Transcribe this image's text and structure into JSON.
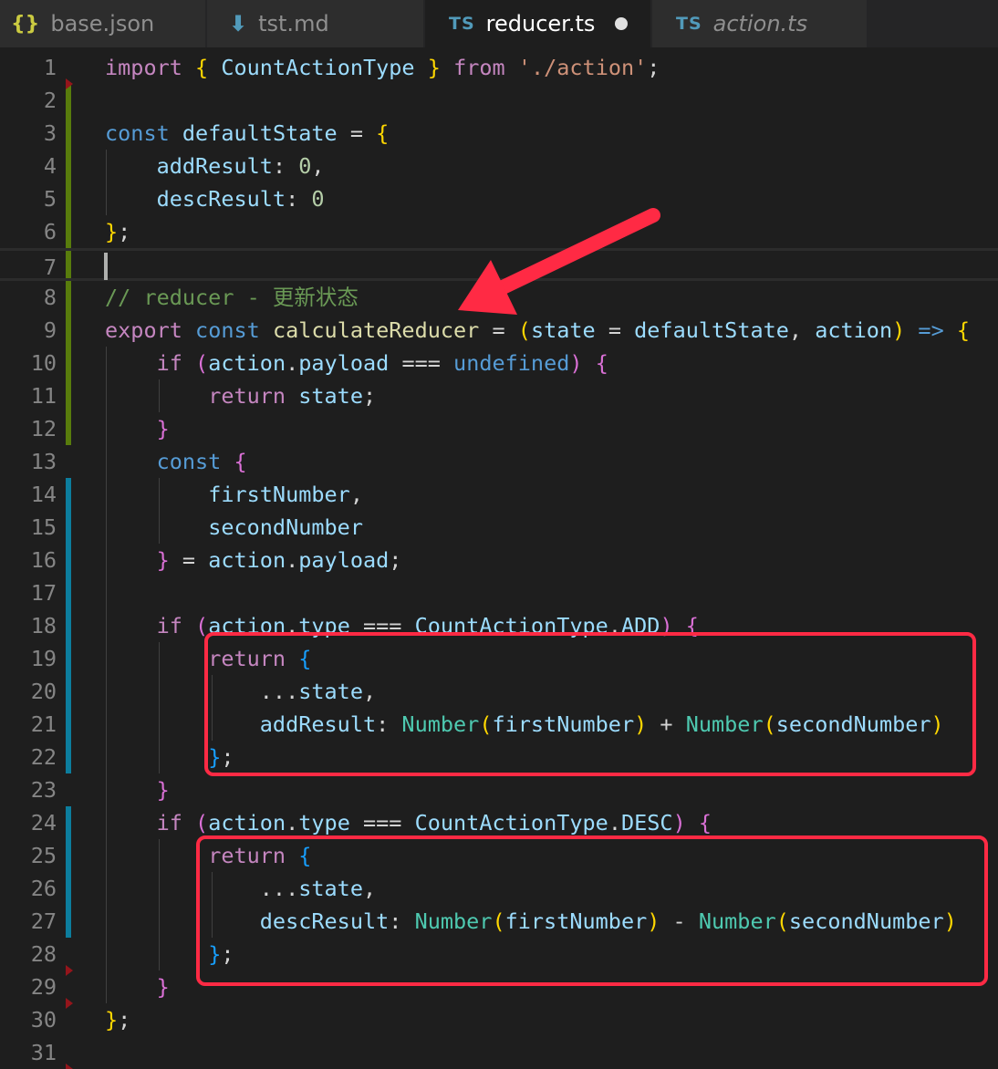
{
  "tabs": [
    {
      "label": "base.json",
      "icon": "json-file-icon",
      "glyph": "{}",
      "active": false
    },
    {
      "label": "tst.md",
      "icon": "markdown-file-icon",
      "glyph": "⬇",
      "active": false
    },
    {
      "label": "reducer.ts",
      "icon": "typescript-file-icon",
      "glyph": "TS",
      "active": true,
      "dirty": true
    },
    {
      "label": "action.ts",
      "icon": "typescript-file-icon",
      "glyph": "TS",
      "active": false,
      "preview": true
    }
  ],
  "editor": {
    "current_line": 7,
    "lines": [
      {
        "n": "1",
        "tokens": [
          [
            "kw",
            "import"
          ],
          [
            "p",
            " "
          ],
          [
            "b1",
            "{"
          ],
          [
            "p",
            " "
          ],
          [
            "id",
            "CountActionType"
          ],
          [
            "p",
            " "
          ],
          [
            "b1",
            "}"
          ],
          [
            "p",
            " "
          ],
          [
            "kw",
            "from"
          ],
          [
            "p",
            " "
          ],
          [
            "str",
            "'./action'"
          ],
          [
            "p",
            ";"
          ]
        ]
      },
      {
        "n": "2",
        "tokens": []
      },
      {
        "n": "3",
        "tokens": [
          [
            "st",
            "const"
          ],
          [
            "p",
            " "
          ],
          [
            "id",
            "defaultState"
          ],
          [
            "p",
            " = "
          ],
          [
            "b1",
            "{"
          ]
        ]
      },
      {
        "n": "4",
        "tokens": [
          [
            "p",
            "    "
          ],
          [
            "id",
            "addResult"
          ],
          [
            "p",
            ": "
          ],
          [
            "num",
            "0"
          ],
          [
            "p",
            ","
          ]
        ]
      },
      {
        "n": "5",
        "tokens": [
          [
            "p",
            "    "
          ],
          [
            "id",
            "descResult"
          ],
          [
            "p",
            ": "
          ],
          [
            "num",
            "0"
          ]
        ]
      },
      {
        "n": "6",
        "tokens": [
          [
            "b1",
            "}"
          ],
          [
            "p",
            ";"
          ]
        ]
      },
      {
        "n": "7",
        "tokens": []
      },
      {
        "n": "8",
        "tokens": [
          [
            "cm",
            "// reducer - 更新状态"
          ]
        ]
      },
      {
        "n": "9",
        "tokens": [
          [
            "kw",
            "export"
          ],
          [
            "p",
            " "
          ],
          [
            "st",
            "const"
          ],
          [
            "p",
            " "
          ],
          [
            "fn",
            "calculateReducer"
          ],
          [
            "p",
            " = "
          ],
          [
            "b1",
            "("
          ],
          [
            "id",
            "state"
          ],
          [
            "p",
            " = "
          ],
          [
            "id",
            "defaultState"
          ],
          [
            "p",
            ", "
          ],
          [
            "id",
            "action"
          ],
          [
            "b1",
            ")"
          ],
          [
            "p",
            " "
          ],
          [
            "st",
            "=>"
          ],
          [
            "p",
            " "
          ],
          [
            "b1",
            "{"
          ]
        ]
      },
      {
        "n": "10",
        "tokens": [
          [
            "p",
            "    "
          ],
          [
            "kw",
            "if"
          ],
          [
            "p",
            " "
          ],
          [
            "b2",
            "("
          ],
          [
            "id",
            "action"
          ],
          [
            "p",
            "."
          ],
          [
            "id",
            "payload"
          ],
          [
            "p",
            " === "
          ],
          [
            "st",
            "undefined"
          ],
          [
            "b2",
            ")"
          ],
          [
            "p",
            " "
          ],
          [
            "b2",
            "{"
          ]
        ]
      },
      {
        "n": "11",
        "tokens": [
          [
            "p",
            "        "
          ],
          [
            "kw",
            "return"
          ],
          [
            "p",
            " "
          ],
          [
            "id",
            "state"
          ],
          [
            "p",
            ";"
          ]
        ]
      },
      {
        "n": "12",
        "tokens": [
          [
            "p",
            "    "
          ],
          [
            "b2",
            "}"
          ]
        ]
      },
      {
        "n": "13",
        "tokens": [
          [
            "p",
            "    "
          ],
          [
            "st",
            "const"
          ],
          [
            "p",
            " "
          ],
          [
            "b2",
            "{"
          ]
        ]
      },
      {
        "n": "14",
        "tokens": [
          [
            "p",
            "        "
          ],
          [
            "id",
            "firstNumber"
          ],
          [
            "p",
            ","
          ]
        ]
      },
      {
        "n": "15",
        "tokens": [
          [
            "p",
            "        "
          ],
          [
            "id",
            "secondNumber"
          ]
        ]
      },
      {
        "n": "16",
        "tokens": [
          [
            "p",
            "    "
          ],
          [
            "b2",
            "}"
          ],
          [
            "p",
            " = "
          ],
          [
            "id",
            "action"
          ],
          [
            "p",
            "."
          ],
          [
            "id",
            "payload"
          ],
          [
            "p",
            ";"
          ]
        ]
      },
      {
        "n": "17",
        "tokens": []
      },
      {
        "n": "18",
        "tokens": [
          [
            "p",
            "    "
          ],
          [
            "kw",
            "if"
          ],
          [
            "p",
            " "
          ],
          [
            "b2",
            "("
          ],
          [
            "id",
            "action"
          ],
          [
            "p",
            "."
          ],
          [
            "id",
            "type"
          ],
          [
            "p",
            " === "
          ],
          [
            "id",
            "CountActionType"
          ],
          [
            "p",
            "."
          ],
          [
            "id",
            "ADD"
          ],
          [
            "b2",
            ")"
          ],
          [
            "p",
            " "
          ],
          [
            "b2",
            "{"
          ]
        ]
      },
      {
        "n": "19",
        "tokens": [
          [
            "p",
            "        "
          ],
          [
            "kw",
            "return"
          ],
          [
            "p",
            " "
          ],
          [
            "b3",
            "{"
          ]
        ]
      },
      {
        "n": "20",
        "tokens": [
          [
            "p",
            "            ..."
          ],
          [
            "id",
            "state"
          ],
          [
            "p",
            ","
          ]
        ]
      },
      {
        "n": "21",
        "tokens": [
          [
            "p",
            "            "
          ],
          [
            "id",
            "addResult"
          ],
          [
            "p",
            ": "
          ],
          [
            "ty",
            "Number"
          ],
          [
            "b1",
            "("
          ],
          [
            "id",
            "firstNumber"
          ],
          [
            "b1",
            ")"
          ],
          [
            "p",
            " + "
          ],
          [
            "ty",
            "Number"
          ],
          [
            "b1",
            "("
          ],
          [
            "id",
            "secondNumber"
          ],
          [
            "b1",
            ")"
          ]
        ]
      },
      {
        "n": "22",
        "tokens": [
          [
            "p",
            "        "
          ],
          [
            "b3",
            "}"
          ],
          [
            "p",
            ";"
          ]
        ]
      },
      {
        "n": "23",
        "tokens": [
          [
            "p",
            "    "
          ],
          [
            "b2",
            "}"
          ]
        ]
      },
      {
        "n": "24",
        "tokens": [
          [
            "p",
            "    "
          ],
          [
            "kw",
            "if"
          ],
          [
            "p",
            " "
          ],
          [
            "b2",
            "("
          ],
          [
            "id",
            "action"
          ],
          [
            "p",
            "."
          ],
          [
            "id",
            "type"
          ],
          [
            "p",
            " === "
          ],
          [
            "id",
            "CountActionType"
          ],
          [
            "p",
            "."
          ],
          [
            "id",
            "DESC"
          ],
          [
            "b2",
            ")"
          ],
          [
            "p",
            " "
          ],
          [
            "b2",
            "{"
          ]
        ]
      },
      {
        "n": "25",
        "tokens": [
          [
            "p",
            "        "
          ],
          [
            "kw",
            "return"
          ],
          [
            "p",
            " "
          ],
          [
            "b3",
            "{"
          ]
        ]
      },
      {
        "n": "26",
        "tokens": [
          [
            "p",
            "            ..."
          ],
          [
            "id",
            "state"
          ],
          [
            "p",
            ","
          ]
        ]
      },
      {
        "n": "27",
        "tokens": [
          [
            "p",
            "            "
          ],
          [
            "id",
            "descResult"
          ],
          [
            "p",
            ": "
          ],
          [
            "ty",
            "Number"
          ],
          [
            "b1",
            "("
          ],
          [
            "id",
            "firstNumber"
          ],
          [
            "b1",
            ")"
          ],
          [
            "p",
            " - "
          ],
          [
            "ty",
            "Number"
          ],
          [
            "b1",
            "("
          ],
          [
            "id",
            "secondNumber"
          ],
          [
            "b1",
            ")"
          ]
        ]
      },
      {
        "n": "28",
        "tokens": [
          [
            "p",
            "        "
          ],
          [
            "b3",
            "}"
          ],
          [
            "p",
            ";"
          ]
        ]
      },
      {
        "n": "29",
        "tokens": [
          [
            "p",
            "    "
          ],
          [
            "b2",
            "}"
          ]
        ]
      },
      {
        "n": "30",
        "tokens": [
          [
            "b1",
            "}"
          ],
          [
            "p",
            ";"
          ]
        ]
      },
      {
        "n": "31",
        "tokens": []
      }
    ]
  },
  "colors": {
    "accent_annotation": "#ff2a44",
    "added_marker": "#587c0c",
    "modified_marker": "#0c7d9d",
    "deleted_marker": "#94151b"
  }
}
